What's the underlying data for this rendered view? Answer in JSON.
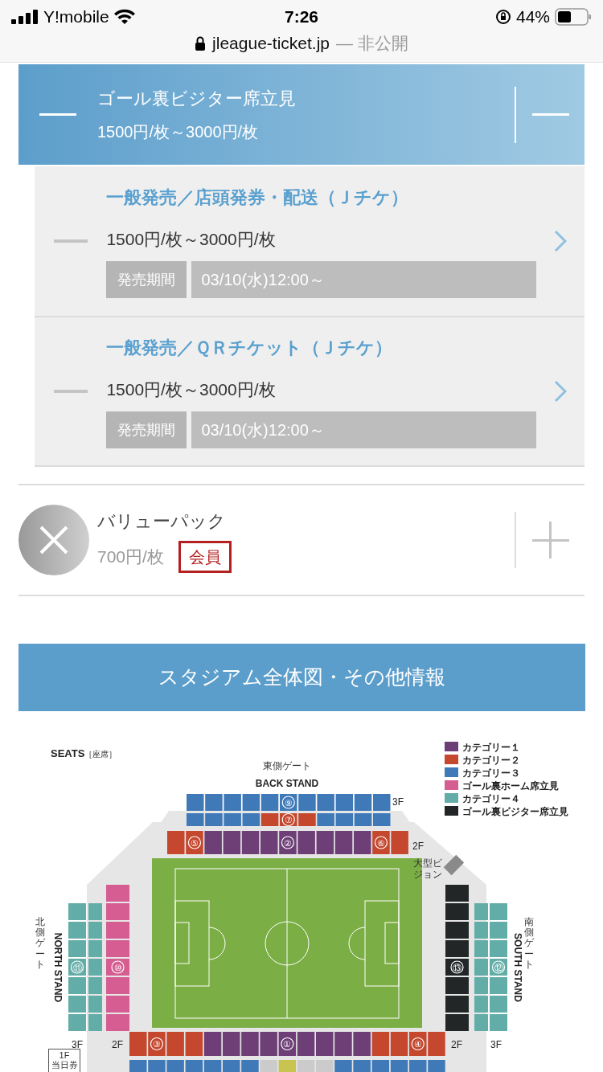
{
  "status_bar": {
    "carrier": "Y!mobile",
    "time": "7:26",
    "battery": "44%"
  },
  "browser": {
    "url": "jleague-ticket.jp",
    "note": "— 非公開"
  },
  "seat_type": {
    "name": "ゴール裏ビジター席立見",
    "price": "1500円/枚～3000円/枚",
    "expanded": true
  },
  "sales": [
    {
      "title": "一般発売／店頭発券・配送（Ｊチケ）",
      "price": "1500円/枚～3000円/枚",
      "period_label": "発売期間",
      "period": "03/10(水)12:00～"
    },
    {
      "title": "一般発売／ＱＲチケット（Ｊチケ）",
      "price": "1500円/枚～3000円/枚",
      "period_label": "発売期間",
      "period": "03/10(水)12:00～"
    }
  ],
  "other_seat": {
    "name": "バリューパック",
    "price": "700円/枚",
    "badge": "会員",
    "expanded": false
  },
  "info_button": "スタジアム全体図・その他情報",
  "stadium_map": {
    "title": "SEATS",
    "title_note": "［座席］",
    "east_gate": "東側ゲート",
    "back_stand": "BACK STAND",
    "north_gate": "北側ゲート",
    "north_stand": "NORTH STAND",
    "south_gate": "南側ゲート",
    "south_stand": "SOUTH STAND",
    "screen_label": "大型ビジョン",
    "floor_labels": [
      "3F",
      "2F",
      "3F",
      "2F",
      "2F",
      "3F"
    ],
    "floor_1f": "1F",
    "ticket_office": "当日券",
    "legend": [
      {
        "label": "カテゴリー１",
        "color": "#6e3f77"
      },
      {
        "label": "カテゴリー２",
        "color": "#c4472e"
      },
      {
        "label": "カテゴリー３",
        "color": "#3f79b8"
      },
      {
        "label": "ゴール裏ホーム席立見",
        "color": "#d65d92"
      },
      {
        "label": "カテゴリー４",
        "color": "#63ada8"
      },
      {
        "label": "ゴール裏ビジター席立見",
        "color": "#222626"
      }
    ],
    "sections": [
      "⑨",
      "⑦",
      "⑤",
      "②",
      "⑥",
      "⑪",
      "⑩",
      "⑬",
      "⑫",
      "③",
      "①",
      "④"
    ]
  }
}
